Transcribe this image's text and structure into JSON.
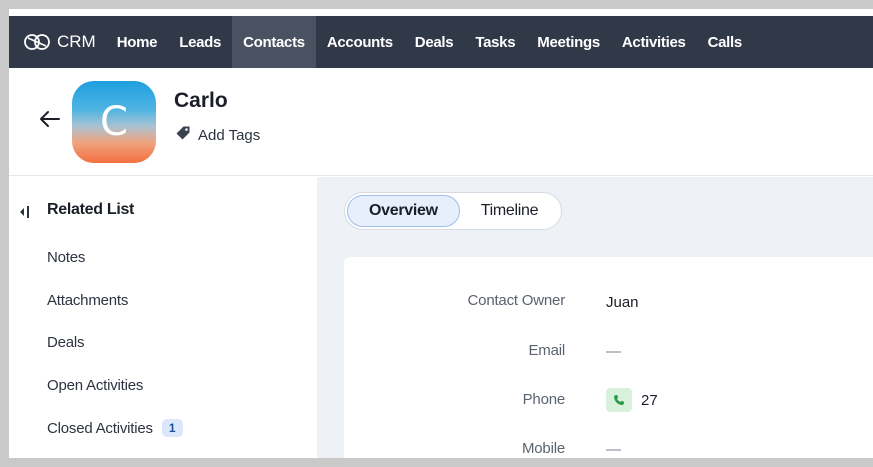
{
  "app": {
    "brand_label": "CRM"
  },
  "nav": {
    "items": [
      {
        "label": "Home"
      },
      {
        "label": "Leads"
      },
      {
        "label": "Contacts",
        "active": true
      },
      {
        "label": "Accounts"
      },
      {
        "label": "Deals"
      },
      {
        "label": "Tasks"
      },
      {
        "label": "Meetings"
      },
      {
        "label": "Activities"
      },
      {
        "label": "Calls"
      }
    ]
  },
  "contact": {
    "avatar_initial": "C",
    "name": "Carlo",
    "add_tags_label": "Add Tags"
  },
  "related_list": {
    "title": "Related List",
    "items": [
      {
        "label": "Notes"
      },
      {
        "label": "Attachments"
      },
      {
        "label": "Deals"
      },
      {
        "label": "Open Activities"
      },
      {
        "label": "Closed Activities",
        "badge": "1"
      }
    ]
  },
  "tabs": [
    {
      "label": "Overview",
      "active": true
    },
    {
      "label": "Timeline"
    }
  ],
  "fields": {
    "contact_owner": {
      "label": "Contact Owner",
      "value": "Juan"
    },
    "email": {
      "label": "Email",
      "value": "—"
    },
    "phone": {
      "label": "Phone",
      "value": "27"
    },
    "mobile": {
      "label": "Mobile",
      "value": "—"
    }
  },
  "colors": {
    "nav_bg": "#313848",
    "nav_active_bg": "#4a5160",
    "main_bg": "#eef1f6",
    "tab_active_border": "#9fbfe8",
    "badge_bg": "#dbe8fb",
    "phone_icon_bg": "#d8f1dc"
  },
  "icons": {
    "brand": "crm-logo-icon",
    "back": "back-arrow-icon",
    "tag": "tag-icon",
    "collapse": "collapse-panel-icon",
    "phone": "phone-icon"
  }
}
